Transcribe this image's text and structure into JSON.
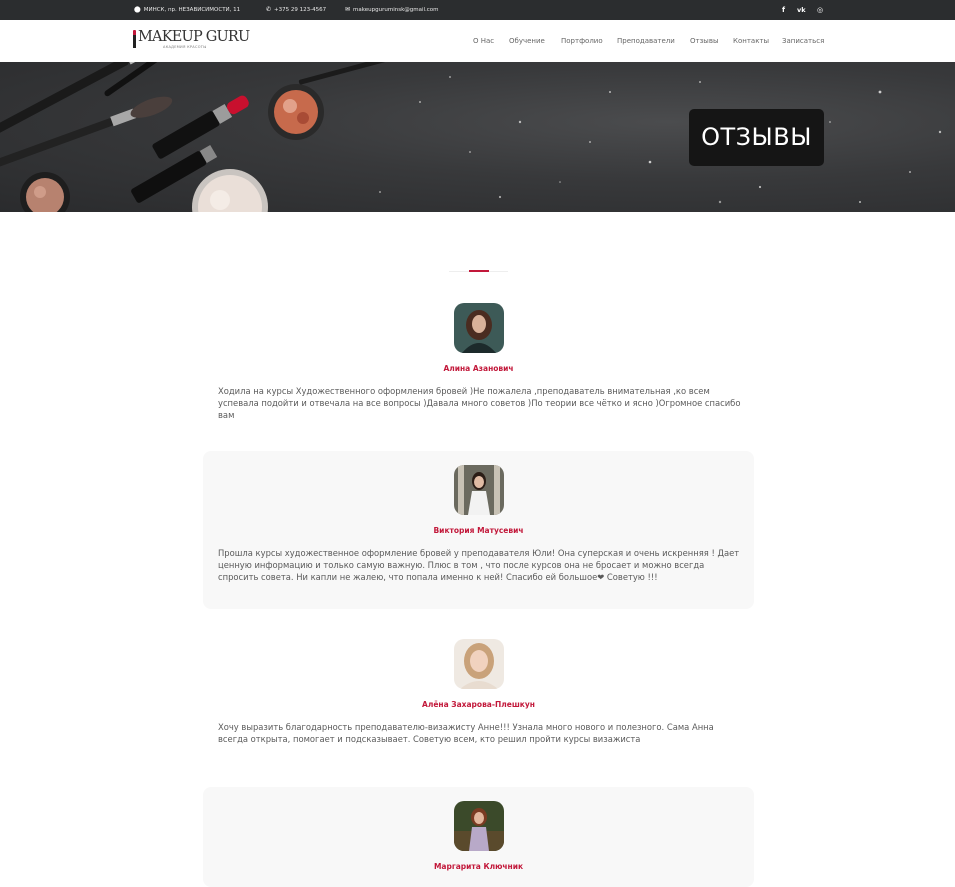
{
  "topbar": {
    "address": "МИНСК, пр. НЕЗАВИСИМОСТИ, 11",
    "phone": "+375 29 123-4567",
    "email": "makeupguruminsk@gmail.com",
    "social": [
      "f",
      "vk",
      "◎"
    ]
  },
  "header": {
    "logo_title": "MAKEUP GURU",
    "logo_subtitle": "АКАДЕМИЯ КРАСОТЫ",
    "nav": [
      "О Нас",
      "Обучение",
      "Портфолио",
      "Преподаватели",
      "Отзывы",
      "Контакты",
      "Записаться"
    ]
  },
  "hero": {
    "title": "ОТЗЫВЫ"
  },
  "colors": {
    "accent": "#c2183a",
    "topbar": "#2b2d2f",
    "card": "#f8f8f8"
  },
  "reviews": [
    {
      "name": "Алина Азанович",
      "text": "Ходила на курсы Художественного оформления бровей )Не пожалела ,преподаватель внимательная ,ко всем успевала подойти и отвечала на все вопросы )Давала много советов )По теории все чётко и ясно )Огромное спасибо вам"
    },
    {
      "name": "Виктория Матусевич",
      "text": "Прошла курсы художественное оформление бровей у преподавателя Юли! Она суперская и очень искренняя ! Дает ценную информацию и только самую важную. Плюс в том , что после курсов она не бросает и можно всегда спросить совета. Ни капли не жалею, что попала именно к ней! Спасибо ей большое❤ Советую !!!"
    },
    {
      "name": "Алёна Захарова-Плешкун",
      "text": "Хочу выразить благодарность преподавателю-визажисту Анне!!! Узнала много нового и полезного. Сама Анна всегда открыта, помогает и подсказывает. Советую всем, кто решил пройти курсы визажиста"
    },
    {
      "name": "Маргарита Ключник",
      "text": ""
    }
  ]
}
